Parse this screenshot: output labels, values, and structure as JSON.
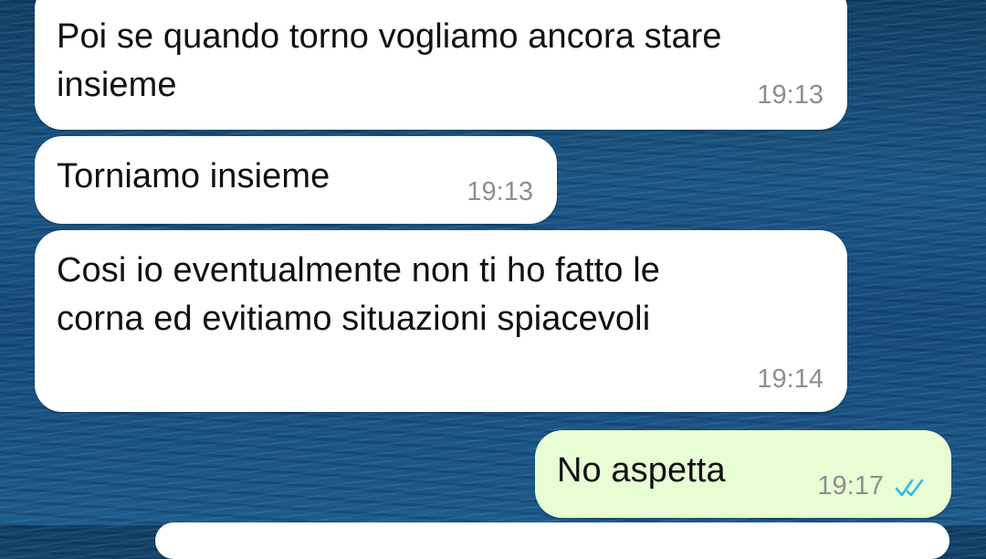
{
  "messages": [
    {
      "direction": "incoming",
      "text": "Poi se quando torno vogliamo ancora stare\ninsieme",
      "time": "19:13"
    },
    {
      "direction": "incoming",
      "text": "Torniamo insieme",
      "time": "19:13"
    },
    {
      "direction": "incoming",
      "text": "Cosi io eventualmente non ti ho fatto le\ncorna ed evitiamo situazioni spiacevoli",
      "time": "19:14"
    },
    {
      "direction": "outgoing",
      "text": "No aspetta",
      "time": "19:17",
      "status": "read",
      "status_icon": "double-check-icon"
    }
  ],
  "colors": {
    "incoming_bubble": "#ffffff",
    "outgoing_bubble": "#e7fdd3",
    "timestamp": "#8a8f93",
    "read_receipt": "#34b7f1"
  }
}
